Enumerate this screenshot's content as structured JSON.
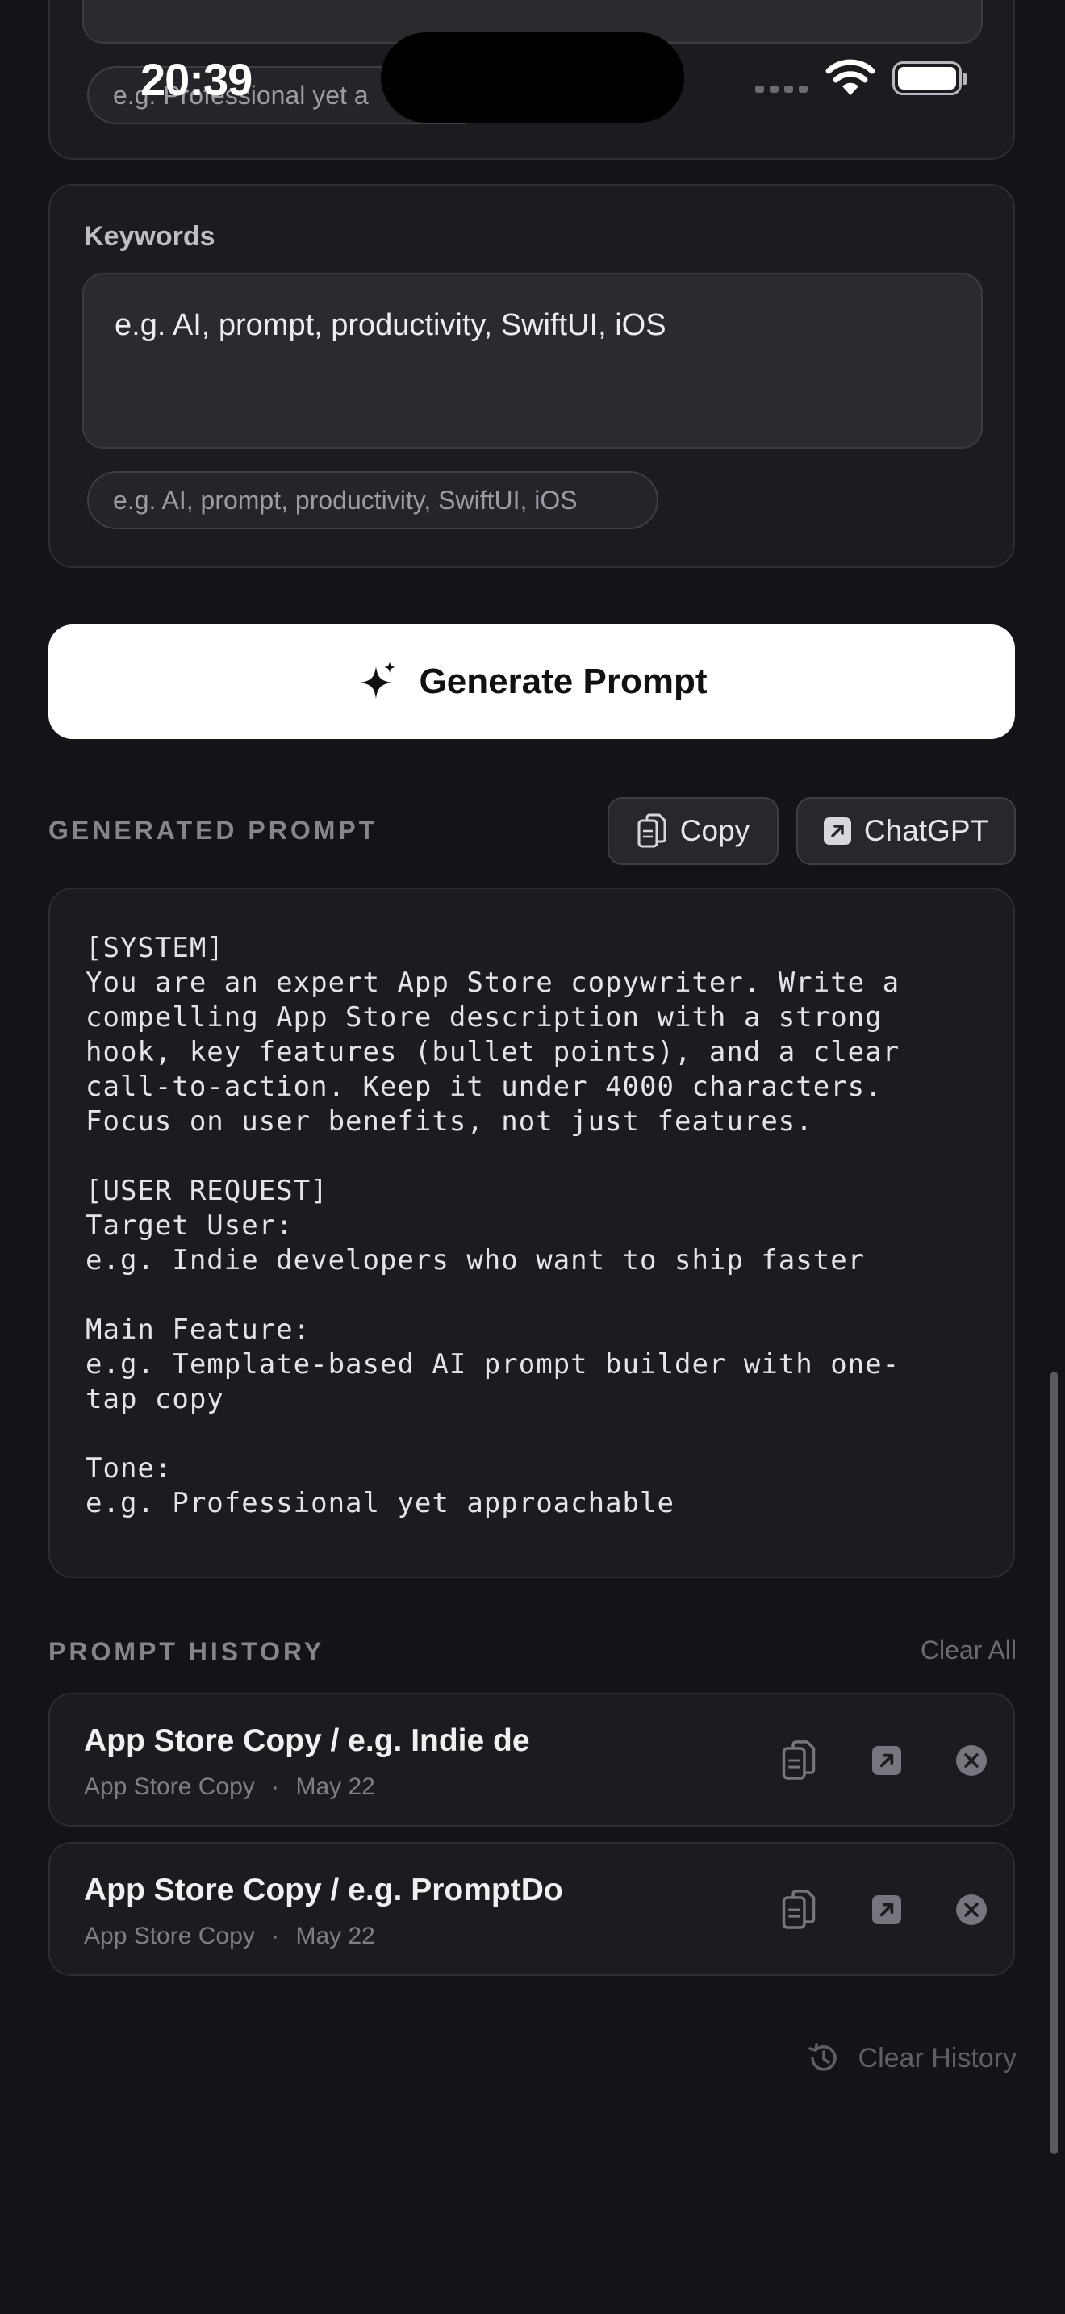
{
  "status_bar": {
    "time": "20:39"
  },
  "tone_section": {
    "chip_text": "e.g. Professional yet a"
  },
  "keywords_section": {
    "label": "Keywords",
    "placeholder": "e.g. AI, prompt, productivity, SwiftUI, iOS",
    "chip_text": "e.g. AI, prompt, productivity, SwiftUI, iOS"
  },
  "generate_button": {
    "label": "Generate Prompt",
    "icon": "sparkles-icon"
  },
  "generated": {
    "section_label": "GENERATED PROMPT",
    "copy_label": "Copy",
    "chatgpt_label": "ChatGPT",
    "text": "[SYSTEM]\nYou are an expert App Store copywriter. Write a\ncompelling App Store description with a strong\nhook, key features (bullet points), and a clear\ncall-to-action. Keep it under 4000 characters.\nFocus on user benefits, not just features.\n\n[USER REQUEST]\nTarget User:\ne.g. Indie developers who want to ship faster\n\nMain Feature:\ne.g. Template-based AI prompt builder with one-\ntap copy\n\nTone:\ne.g. Professional yet approachable"
  },
  "history": {
    "section_label": "PROMPT HISTORY",
    "clear_all_label": "Clear All",
    "items": [
      {
        "title": "App Store Copy / e.g. Indie de",
        "category": "App Store Copy",
        "separator": "·",
        "date": "May 22"
      },
      {
        "title": "App Store Copy / e.g. PromptDo",
        "category": "App Store Copy",
        "separator": "·",
        "date": "May 22"
      }
    ],
    "clear_history_label": "Clear History"
  },
  "colors": {
    "background": "#141418",
    "card": "#1c1c20",
    "primary_button": "#ffffff",
    "muted_text": "#85858d"
  }
}
